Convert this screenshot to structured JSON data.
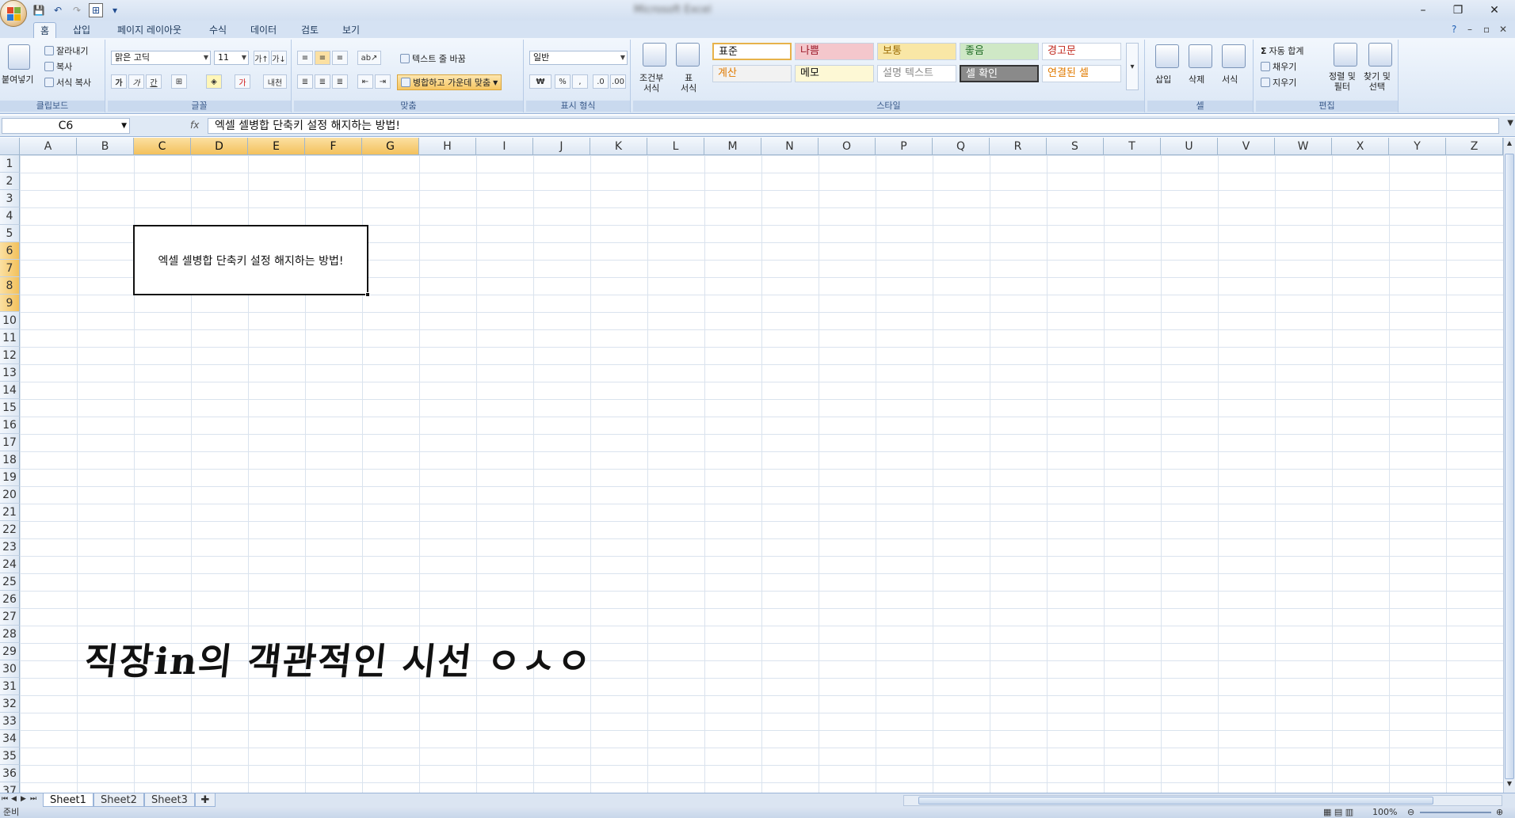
{
  "qat": {
    "more_label": "▾"
  },
  "title": "Microsoft Excel",
  "window_controls": {
    "minimize": "–",
    "restore": "❐",
    "close": "✕"
  },
  "tabs": [
    "홈",
    "삽입",
    "페이지 레이아웃",
    "수식",
    "데이터",
    "검토",
    "보기"
  ],
  "tabbar_right": {
    "help": "?",
    "min": "–",
    "restore": "▫",
    "close": "✕"
  },
  "clipboard": {
    "paste": "붙여넣기",
    "cut": "잘라내기",
    "copy": "복사",
    "format_painter": "서식 복사",
    "label": "클립보드"
  },
  "font": {
    "name": "맑은 고딕",
    "size": "11",
    "bold": "가",
    "italic": "가",
    "underline": "간",
    "label": "글꼴",
    "phonetic": "내천"
  },
  "alignment": {
    "wrap": "텍스트 줄 바꿈",
    "merge": "병합하고 가운데 맞춤",
    "label": "맞춤"
  },
  "number": {
    "format": "일반",
    "currency": "₩",
    "percent": "%",
    "comma": ",",
    "label": "표시 형식"
  },
  "styles": {
    "conditional": "조건부\n서식",
    "table": "표\n서식",
    "cells": [
      {
        "text": "표준",
        "bg": "#ffffff",
        "color": "#111111"
      },
      {
        "text": "나쁨",
        "bg": "#f4c7cc",
        "color": "#9c1a2a"
      },
      {
        "text": "보통",
        "bg": "#f9e7a6",
        "color": "#9a6a00"
      },
      {
        "text": "좋음",
        "bg": "#cfe8c6",
        "color": "#1e6b23"
      },
      {
        "text": "경고문",
        "bg": "#ffffff",
        "color": "#c0271c"
      },
      {
        "text": "계산",
        "bg": "#f2f2f2",
        "color": "#e07a00"
      },
      {
        "text": "메모",
        "bg": "#fdf8d5",
        "color": "#111111"
      },
      {
        "text": "설명 텍스트",
        "bg": "#ffffff",
        "color": "#888888"
      },
      {
        "text": "셀 확인",
        "bg": "#8a8a8a",
        "color": "#ffffff"
      },
      {
        "text": "연결된 셀",
        "bg": "#ffffff",
        "color": "#e07a00"
      }
    ],
    "label": "스타일"
  },
  "cells_group": {
    "insert": "삽입",
    "delete": "삭제",
    "format": "서식",
    "label": "셀"
  },
  "editing": {
    "autosum": "자동 합계",
    "fill": "채우기",
    "clear": "지우기",
    "sort": "정렬 및\n필터",
    "find": "찾기 및\n선택",
    "label": "편집"
  },
  "formula_bar": {
    "name_box": "C6",
    "fx": "fx",
    "content": "엑셀 셀병합 단축키 설정 해지하는 방법!"
  },
  "columns": [
    "A",
    "B",
    "C",
    "D",
    "E",
    "F",
    "G",
    "H",
    "I",
    "J",
    "K",
    "L",
    "M",
    "N",
    "O",
    "P",
    "Q",
    "R",
    "S",
    "T",
    "U",
    "V",
    "W",
    "X",
    "Y",
    "Z"
  ],
  "selected_columns": [
    "C",
    "D",
    "E",
    "F",
    "G"
  ],
  "rows": [
    "1",
    "2",
    "3",
    "4",
    "5",
    "6",
    "7",
    "8",
    "9",
    "10",
    "11",
    "12",
    "13",
    "14",
    "15",
    "16",
    "17",
    "18",
    "19",
    "20",
    "21",
    "22",
    "23",
    "24",
    "25",
    "26",
    "27",
    "28",
    "29",
    "30",
    "31",
    "32",
    "33",
    "34",
    "35",
    "36",
    "37"
  ],
  "selected_rows": [
    "6",
    "7",
    "8",
    "9"
  ],
  "merged_cell_text": "엑셀 셀병합 단축키 설정 해지하는 방법!",
  "watermark": "직장in의 객관적인 시선 ㅇㅅㅇ",
  "sheets": [
    "Sheet1",
    "Sheet2",
    "Sheet3"
  ],
  "status": {
    "ready": "준비",
    "zoom": "100%"
  }
}
